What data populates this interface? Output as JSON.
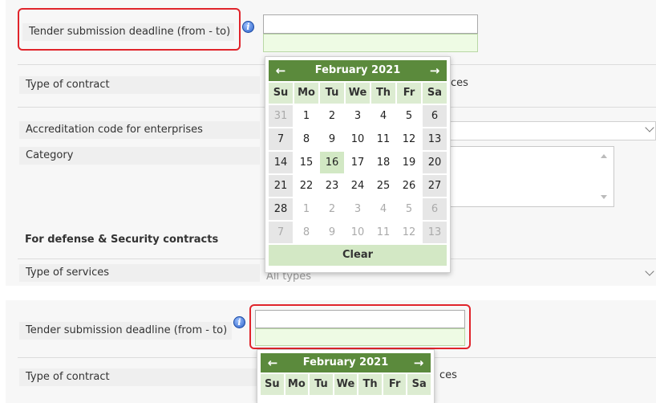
{
  "top": {
    "deadline_label": "Tender submission deadline (from - to)",
    "contract_label": "Type of contract",
    "contract_value_partial": "ces",
    "accreditation_label": "Accreditation code for enterprises",
    "category_label": "Category",
    "defense_title": "For defense & Security contracts",
    "services_label": "Type of services",
    "services_value": "All types",
    "info_glyph": "i"
  },
  "calendar_top": {
    "month": "February 2021",
    "prev_glyph": "←",
    "next_glyph": "→",
    "weekdays": [
      "Su",
      "Mo",
      "Tu",
      "We",
      "Th",
      "Fr",
      "Sa"
    ],
    "weeks": [
      [
        "31",
        "1",
        "2",
        "3",
        "4",
        "5",
        "6"
      ],
      [
        "7",
        "8",
        "9",
        "10",
        "11",
        "12",
        "13"
      ],
      [
        "14",
        "15",
        "16",
        "17",
        "18",
        "19",
        "20"
      ],
      [
        "21",
        "22",
        "23",
        "24",
        "25",
        "26",
        "27"
      ],
      [
        "28",
        "1",
        "2",
        "3",
        "4",
        "5",
        "6"
      ],
      [
        "7",
        "8",
        "9",
        "10",
        "11",
        "12",
        "13"
      ]
    ],
    "today": "16",
    "clear_label": "Clear"
  },
  "bottom": {
    "deadline_label": "Tender submission deadline (from - to)",
    "contract_label": "Type of contract",
    "contract_value_partial": "ces",
    "info_glyph": "i"
  },
  "calendar_bottom": {
    "month": "February 2021",
    "prev_glyph": "←",
    "next_glyph": "→",
    "weekdays": [
      "Su",
      "Mo",
      "Tu",
      "We",
      "Th",
      "Fr",
      "Sa"
    ]
  },
  "colors": {
    "calendar_header": "#5b8a3c",
    "weekday_header_bg": "#dcecd1",
    "highlight_box": "#e0242b",
    "input_green": "#eefbe4"
  }
}
